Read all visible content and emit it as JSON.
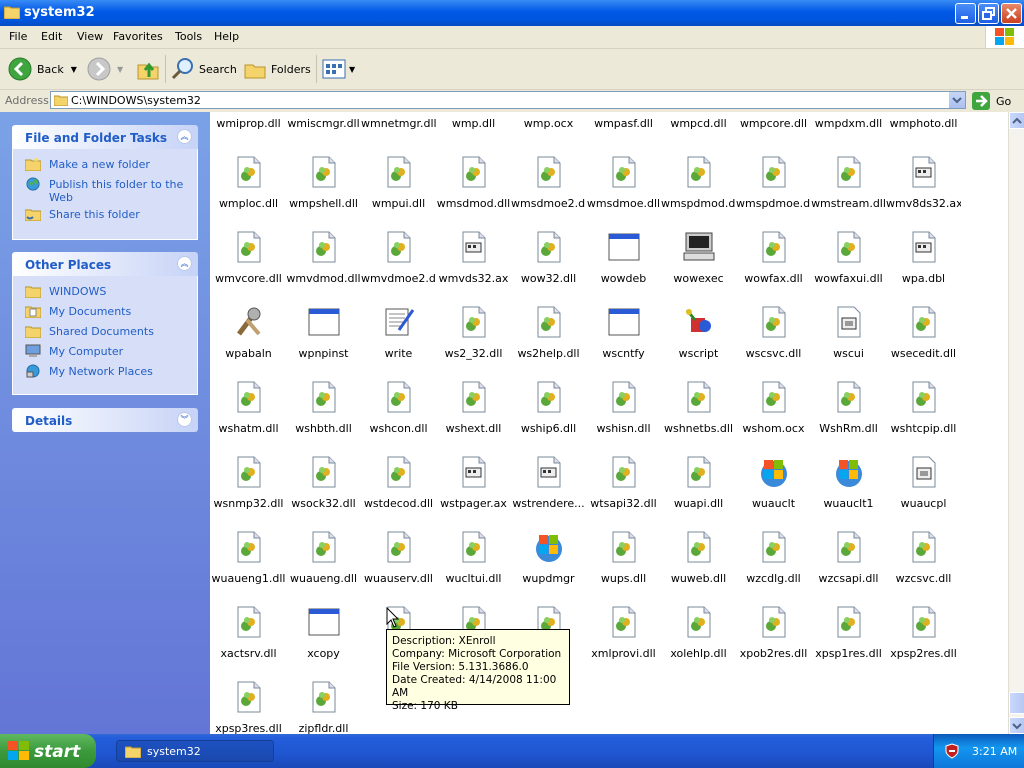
{
  "window": {
    "title": "system32"
  },
  "menu": [
    "File",
    "Edit",
    "View",
    "Favorites",
    "Tools",
    "Help"
  ],
  "toolbar": {
    "back": "Back",
    "search": "Search",
    "folders": "Folders"
  },
  "address": {
    "label": "Address",
    "path": "C:\\WINDOWS\\system32",
    "go": "Go"
  },
  "tasks": {
    "title": "File and Folder Tasks",
    "items": [
      "Make a new folder",
      "Publish this folder to the Web",
      "Share this folder"
    ]
  },
  "other": {
    "title": "Other Places",
    "items": [
      "WINDOWS",
      "My Documents",
      "Shared Documents",
      "My Computer",
      "My Network Places"
    ]
  },
  "details": {
    "title": "Details"
  },
  "top_row": [
    "wmiprop.dll",
    "wmiscmgr.dll",
    "wmnetmgr.dll",
    "wmp.dll",
    "wmp.ocx",
    "wmpasf.dll",
    "wmpcd.dll",
    "wmpcore.dll",
    "wmpdxm.dll",
    "wmphoto.dll"
  ],
  "rows": [
    [
      [
        "wmploc.dll",
        "dll"
      ],
      [
        "wmpshell.dll",
        "dll"
      ],
      [
        "wmpui.dll",
        "dll"
      ],
      [
        "wmsdmod.dll",
        "dll"
      ],
      [
        "wmsdmoe2.dll",
        "dll"
      ],
      [
        "wmsdmoe.dll",
        "dll"
      ],
      [
        "wmspdmod.dll",
        "dll"
      ],
      [
        "wmspdmoe.dll",
        "dll"
      ],
      [
        "wmstream.dll",
        "dll"
      ],
      [
        "wmv8ds32.ax",
        "ax"
      ]
    ],
    [
      [
        "wmvcore.dll",
        "dll"
      ],
      [
        "wmvdmod.dll",
        "dll"
      ],
      [
        "wmvdmoe2.dll",
        "dll"
      ],
      [
        "wmvds32.ax",
        "ax"
      ],
      [
        "wow32.dll",
        "dll"
      ],
      [
        "wowdeb",
        "exe"
      ],
      [
        "wowexec",
        "computer"
      ],
      [
        "wowfax.dll",
        "dll"
      ],
      [
        "wowfaxui.dll",
        "dll"
      ],
      [
        "wpa.dbl",
        "ax"
      ]
    ],
    [
      [
        "wpabaln",
        "tools"
      ],
      [
        "wpnpinst",
        "exe"
      ],
      [
        "write",
        "write"
      ],
      [
        "ws2_32.dll",
        "dll"
      ],
      [
        "ws2help.dll",
        "dll"
      ],
      [
        "wscntfy",
        "exe"
      ],
      [
        "wscript",
        "wscript"
      ],
      [
        "wscsvc.dll",
        "dll"
      ],
      [
        "wscui",
        "cpl"
      ],
      [
        "wsecedit.dll",
        "dll"
      ]
    ],
    [
      [
        "wshatm.dll",
        "dll"
      ],
      [
        "wshbth.dll",
        "dll"
      ],
      [
        "wshcon.dll",
        "dll"
      ],
      [
        "wshext.dll",
        "dll"
      ],
      [
        "wship6.dll",
        "dll"
      ],
      [
        "wshisn.dll",
        "dll"
      ],
      [
        "wshnetbs.dll",
        "dll"
      ],
      [
        "wshom.ocx",
        "dll"
      ],
      [
        "WshRm.dll",
        "dll"
      ],
      [
        "wshtcpip.dll",
        "dll"
      ]
    ],
    [
      [
        "wsnmp32.dll",
        "dll"
      ],
      [
        "wsock32.dll",
        "dll"
      ],
      [
        "wstdecod.dll",
        "dll"
      ],
      [
        "wstpager.ax",
        "ax"
      ],
      [
        "wstrendere...",
        "ax"
      ],
      [
        "wtsapi32.dll",
        "dll"
      ],
      [
        "wuapi.dll",
        "dll"
      ],
      [
        "wuauclt",
        "winlogo"
      ],
      [
        "wuauclt1",
        "winlogo"
      ],
      [
        "wuaucpl",
        "cpl"
      ]
    ],
    [
      [
        "wuaueng1.dll",
        "dll"
      ],
      [
        "wuaueng.dll",
        "dll"
      ],
      [
        "wuauserv.dll",
        "dll"
      ],
      [
        "wucltui.dll",
        "dll"
      ],
      [
        "wupdmgr",
        "winlogo"
      ],
      [
        "wups.dll",
        "dll"
      ],
      [
        "wuweb.dll",
        "dll"
      ],
      [
        "wzcdlg.dll",
        "dll"
      ],
      [
        "wzcsapi.dll",
        "dll"
      ],
      [
        "wzcsvc.dll",
        "dll"
      ]
    ],
    [
      [
        "xactsrv.dll",
        "dll"
      ],
      [
        "xcopy",
        "exe"
      ],
      [
        "xe",
        "dll"
      ],
      [
        "",
        "dll"
      ],
      [
        "",
        "dll"
      ],
      [
        "xmlprovi.dll",
        "dll"
      ],
      [
        "xolehlp.dll",
        "dll"
      ],
      [
        "xpob2res.dll",
        "dll"
      ],
      [
        "xpsp1res.dll",
        "dll"
      ],
      [
        "xpsp2res.dll",
        "dll"
      ]
    ],
    [
      [
        "xpsp3res.dll",
        "dll"
      ],
      [
        "zipfldr.dll",
        "dll"
      ]
    ]
  ],
  "tooltip": {
    "line1": "Description: XEnroll",
    "line2": "Company: Microsoft Corporation",
    "line3": "File Version: 5.131.3686.0",
    "line4": "Date Created: 4/14/2008 11:00 AM",
    "line5": "Size: 170 KB"
  },
  "taskbar": {
    "start": "start",
    "task": "system32",
    "clock": "3:21 AM"
  }
}
